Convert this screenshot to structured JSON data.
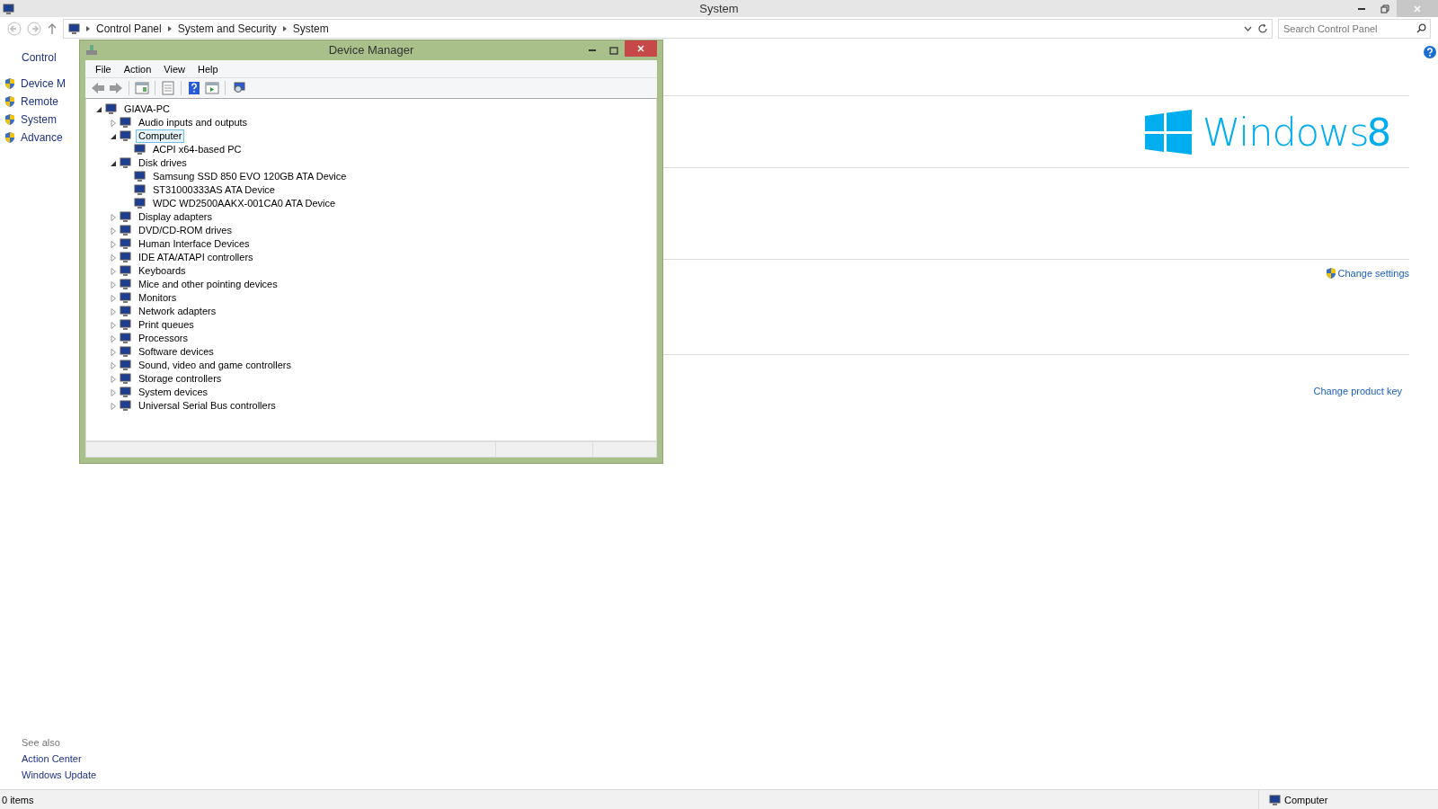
{
  "window": {
    "title": "System"
  },
  "address_bar": {
    "breadcrumb": [
      "Control Panel",
      "System and Security",
      "System"
    ]
  },
  "search": {
    "placeholder": "Search Control Panel"
  },
  "sidebar": {
    "heading": "Control",
    "links": [
      "Device M",
      "Remote",
      "System",
      "Advance"
    ]
  },
  "see_also": {
    "heading": "See also",
    "links": [
      "Action Center",
      "Windows Update"
    ]
  },
  "logo": {
    "name": "Windows",
    "version": "8"
  },
  "actions": {
    "change_settings": "Change settings",
    "change_product_key": "Change product key"
  },
  "status_bar": {
    "items": "0 items",
    "location": "Computer"
  },
  "device_manager": {
    "title": "Device Manager",
    "menu": [
      "File",
      "Action",
      "View",
      "Help"
    ],
    "tree": {
      "label": "GIAVA-PC",
      "expanded": true,
      "selected": false,
      "children": [
        {
          "label": "Audio inputs and outputs",
          "expanded": false,
          "selected": false
        },
        {
          "label": "Computer",
          "expanded": true,
          "selected": true,
          "children": [
            {
              "label": "ACPI x64-based PC",
              "selected": false
            }
          ]
        },
        {
          "label": "Disk drives",
          "expanded": true,
          "selected": false,
          "children": [
            {
              "label": "Samsung SSD 850 EVO 120GB ATA Device",
              "selected": false
            },
            {
              "label": "ST31000333AS ATA Device",
              "selected": false
            },
            {
              "label": "WDC WD2500AAKX-001CA0 ATA Device",
              "selected": false
            }
          ]
        },
        {
          "label": "Display adapters",
          "expanded": false,
          "selected": false
        },
        {
          "label": "DVD/CD-ROM drives",
          "expanded": false,
          "selected": false
        },
        {
          "label": "Human Interface Devices",
          "expanded": false,
          "selected": false
        },
        {
          "label": "IDE ATA/ATAPI controllers",
          "expanded": false,
          "selected": false
        },
        {
          "label": "Keyboards",
          "expanded": false,
          "selected": false
        },
        {
          "label": "Mice and other pointing devices",
          "expanded": false,
          "selected": false
        },
        {
          "label": "Monitors",
          "expanded": false,
          "selected": false
        },
        {
          "label": "Network adapters",
          "expanded": false,
          "selected": false
        },
        {
          "label": "Print queues",
          "expanded": false,
          "selected": false
        },
        {
          "label": "Processors",
          "expanded": false,
          "selected": false
        },
        {
          "label": "Software devices",
          "expanded": false,
          "selected": false
        },
        {
          "label": "Sound, video and game controllers",
          "expanded": false,
          "selected": false
        },
        {
          "label": "Storage controllers",
          "expanded": false,
          "selected": false
        },
        {
          "label": "System devices",
          "expanded": false,
          "selected": false
        },
        {
          "label": "Universal Serial Bus controllers",
          "expanded": false,
          "selected": false
        }
      ]
    }
  }
}
